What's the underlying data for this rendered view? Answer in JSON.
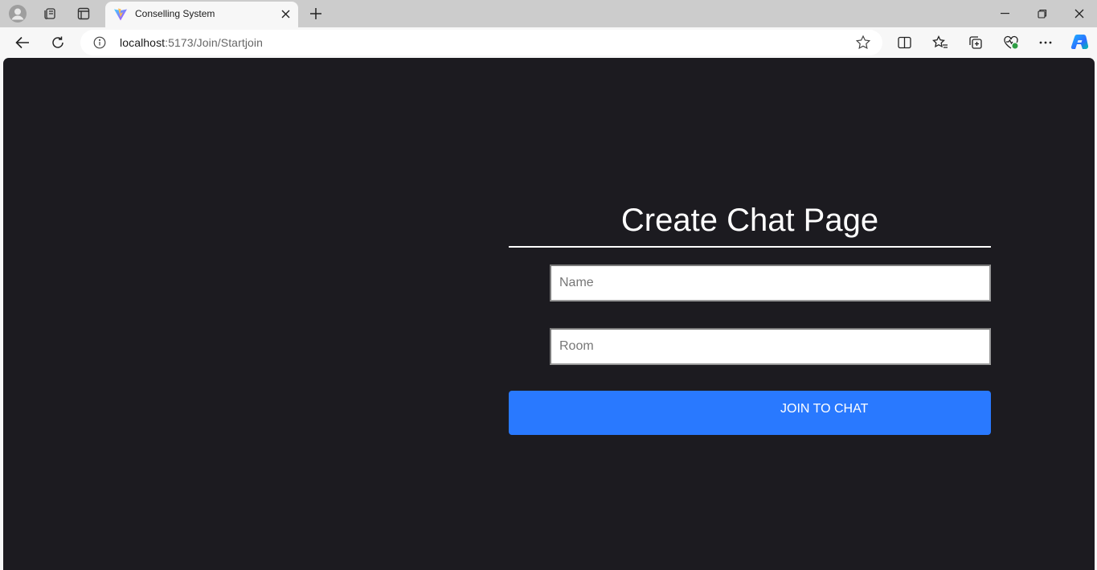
{
  "browser": {
    "tab": {
      "title": "Conselling System"
    },
    "address": {
      "host": "localhost",
      "path": ":5173/Join/Startjoin"
    }
  },
  "page": {
    "title": "Create Chat Page",
    "name_input": {
      "placeholder": "Name",
      "value": ""
    },
    "room_input": {
      "placeholder": "Room",
      "value": ""
    },
    "join_button_label": "JOIN TO CHAT"
  },
  "colors": {
    "page_background": "#1c1b20",
    "button": "#2979ff",
    "title_text": "#ffffff"
  }
}
